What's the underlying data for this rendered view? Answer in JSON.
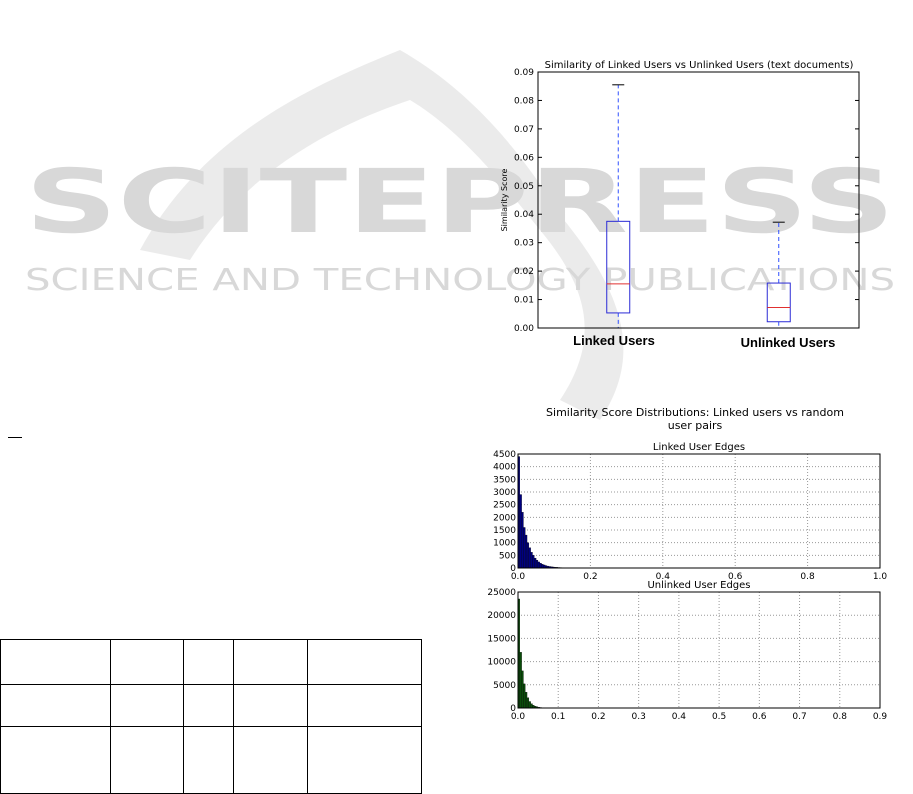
{
  "watermark": {
    "line1": "SCITEPRESS",
    "line2": "SCIENCE AND TECHNOLOGY PUBLICATIONS"
  },
  "colors": {
    "box_edge": "#2b2bd6",
    "median": "#e03030",
    "whisker": "#3050ff",
    "cap": "#000000",
    "linked_bars": "#000080",
    "unlinked_bars": "#0a4d0a",
    "watermark": "#d8d8d8"
  },
  "chart_data": [
    {
      "type": "box",
      "title": "Similarity of Linked Users vs Unlinked Users (text documents)",
      "ylabel": "Similarity Score",
      "ylim": [
        0.0,
        0.09
      ],
      "yticks": [
        "0.00",
        "0.01",
        "0.02",
        "0.03",
        "0.04",
        "0.05",
        "0.06",
        "0.07",
        "0.08",
        "0.09"
      ],
      "grid": false,
      "series": [
        {
          "name": "Linked Users",
          "whisker_low": 0.0,
          "q1": 0.0053,
          "median": 0.0155,
          "q3": 0.0375,
          "whisker_high": 0.0855
        },
        {
          "name": "Unlinked Users",
          "whisker_low": 0.0,
          "q1": 0.0022,
          "median": 0.0072,
          "q3": 0.0158,
          "whisker_high": 0.0372
        }
      ]
    },
    {
      "type": "bar",
      "title": "Similarity Score Distributions: Linked users  vs random user pairs",
      "subtitle": "Linked User Edges",
      "xlim": [
        0.0,
        1.0
      ],
      "ylim": [
        0,
        4500
      ],
      "xticks": [
        "0.0",
        "0.2",
        "0.4",
        "0.6",
        "0.8",
        "1.0"
      ],
      "yticks": [
        "0",
        "500",
        "1000",
        "1500",
        "2000",
        "2500",
        "3000",
        "3500",
        "4000",
        "4500"
      ],
      "grid": true,
      "bin_width": 0.005,
      "values": [
        4400,
        2900,
        2200,
        1600,
        1300,
        1000,
        800,
        620,
        500,
        390,
        310,
        240,
        190,
        150,
        120,
        95,
        75,
        60,
        50,
        40,
        32,
        26,
        21,
        17,
        14,
        11,
        9,
        7,
        6,
        5,
        4,
        3,
        3,
        2,
        2,
        2,
        1,
        1,
        1,
        1
      ]
    },
    {
      "type": "bar",
      "title": "Unlinked User Edges",
      "xlim": [
        0.0,
        0.9
      ],
      "ylim": [
        0,
        25000
      ],
      "xticks": [
        "0.0",
        "0.1",
        "0.2",
        "0.3",
        "0.4",
        "0.5",
        "0.6",
        "0.7",
        "0.8",
        "0.9"
      ],
      "yticks": [
        "0",
        "5000",
        "10000",
        "15000",
        "20000",
        "25000"
      ],
      "grid": true,
      "bin_width": 0.0045,
      "values": [
        23500,
        12000,
        8000,
        5200,
        3400,
        2200,
        1400,
        900,
        600,
        400,
        260,
        170,
        110,
        70,
        45,
        30,
        20,
        12,
        8,
        5
      ]
    }
  ],
  "hist_figure": {
    "title_line1": "Similarity Score Distributions: Linked users  vs random",
    "title_line2": "user pairs"
  }
}
